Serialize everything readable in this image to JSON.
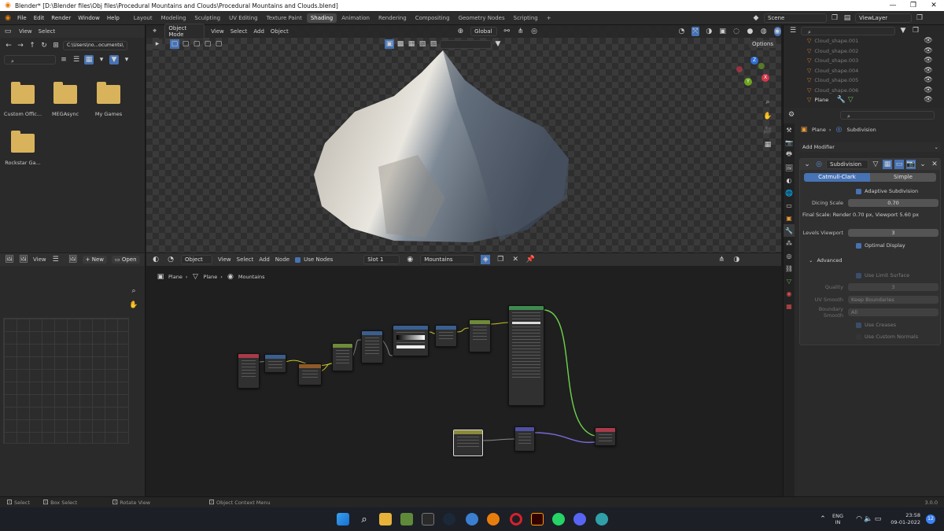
{
  "window": {
    "title": "Blender* [D:\\Blender files\\Obj files\\Procedural Mountains and Clouds\\Procedural Mountains and Clouds.blend]",
    "minimize": "—",
    "maximize": "❐",
    "close": "✕"
  },
  "menu": [
    "File",
    "Edit",
    "Render",
    "Window",
    "Help"
  ],
  "workspaces": [
    "Layout",
    "Modeling",
    "Sculpting",
    "UV Editing",
    "Texture Paint",
    "Shading",
    "Animation",
    "Rendering",
    "Compositing",
    "Geometry Nodes",
    "Scripting"
  ],
  "active_workspace": "Shading",
  "add_workspace": "+",
  "scene": "Scene",
  "view_layer": "ViewLayer",
  "file_browser": {
    "view": "View",
    "select": "Select",
    "path": "C:\\Users\\no...ocuments\\",
    "folders": [
      "Custom Offic...",
      "MEGAsync",
      "My Games",
      "Rockstar Ga..."
    ]
  },
  "viewport": {
    "mode": "Object Mode",
    "view": "View",
    "select": "Select",
    "add": "Add",
    "object": "Object",
    "transform": "Global",
    "options": "Options",
    "axis_x": "X",
    "axis_y": "Y",
    "axis_z": "Z"
  },
  "outliner": {
    "items": [
      "Cloud_shape.001",
      "Cloud_shape.002",
      "Cloud_shape.003",
      "Cloud_shape.004",
      "Cloud_shape.005",
      "Cloud_shape.006",
      "Plane"
    ]
  },
  "properties": {
    "breadcrumb_object": "Plane",
    "breadcrumb_modifier": "Subdivision",
    "add_modifier": "Add Modifier",
    "modifier_name": "Subdivision",
    "catmull": "Catmull-Clark",
    "simple": "Simple",
    "adaptive": "Adaptive Subdivision",
    "dicing_label": "Dicing Scale",
    "dicing_value": "0.70",
    "final_scale": "Final Scale: Render 0.70 px, Viewport 5.60 px",
    "levels_label": "Levels Viewport",
    "levels_value": "3",
    "optimal": "Optimal Display",
    "advanced": "Advanced",
    "limit_surface": "Use Limit Surface",
    "quality_label": "Quality",
    "quality_value": "3",
    "uv_smooth_label": "UV Smooth",
    "uv_smooth_value": "Keep Boundaries",
    "boundary_label": "Boundary Smooth",
    "boundary_value": "All",
    "use_creases": "Use Creases",
    "custom_normals": "Use Custom Normals"
  },
  "image_editor": {
    "view": "View",
    "new": "New",
    "open": "Open"
  },
  "node_editor": {
    "object": "Object",
    "view": "View",
    "select": "Select",
    "add": "Add",
    "node": "Node",
    "use_nodes": "Use Nodes",
    "slot": "Slot 1",
    "material": "Mountains",
    "crumb_1": "Plane",
    "crumb_2": "Plane",
    "crumb_3": "Mountains"
  },
  "status": {
    "select": "Select",
    "box_select": "Box Select",
    "rotate": "Rotate View",
    "context": "Object Context Menu",
    "version": "3.0.0"
  },
  "taskbar": {
    "lang": "ENG",
    "region": "IN",
    "time": "23:58",
    "date": "09-01-2022",
    "notifications": "12"
  },
  "colors": {
    "accent": "#4772b3",
    "active_object": "#d67c2a",
    "header": "#2b2b2b"
  }
}
